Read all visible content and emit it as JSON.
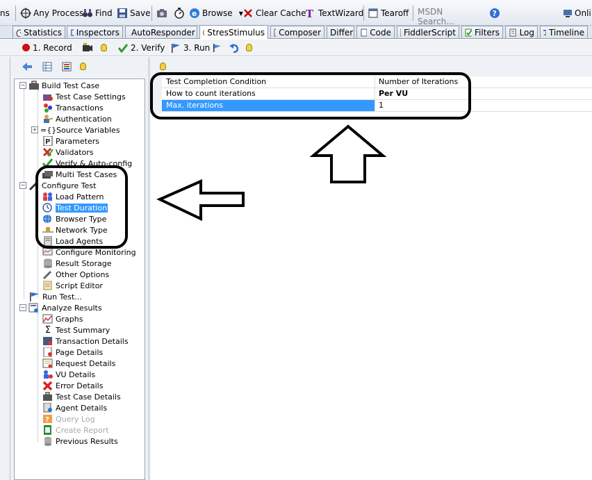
{
  "top_toolbar": {
    "partial_left": "ns",
    "any_process": "Any Process",
    "find": "Find",
    "save": "Save",
    "browse": "Browse",
    "clear_cache": "Clear Cache",
    "textwizard": "TextWizard",
    "tearoff": "Tearoff",
    "search_placeholder": "MSDN Search...",
    "online_partial": "Onli"
  },
  "tabs": [
    {
      "label": "Statistics",
      "icon": "stopwatch-icon"
    },
    {
      "label": "Inspectors",
      "icon": "inspect-icon"
    },
    {
      "label": "AutoResponder",
      "icon": "lightning-icon"
    },
    {
      "label": "StresStimulus",
      "icon": "stresstimulus-icon",
      "active": true
    },
    {
      "label": "Composer",
      "icon": "pencil-icon"
    },
    {
      "label": "Differ",
      "icon": ""
    },
    {
      "label": "Code",
      "icon": "page-icon"
    },
    {
      "label": "FiddlerScript",
      "icon": "js-icon"
    },
    {
      "label": "Filters",
      "icon": "checkbox-icon"
    },
    {
      "label": "Log",
      "icon": "page-icon"
    },
    {
      "label": "Timeline",
      "icon": "timeline-icon"
    }
  ],
  "ss_toolbar": {
    "record": "1. Record",
    "verify": "2. Verify",
    "run": "3. Run"
  },
  "tree": {
    "build_test_case": "Build Test Case",
    "test_case_settings": "Test Case Settings",
    "transactions": "Transactions",
    "authentication": "Authentication",
    "source_variables": "Source Variables",
    "parameters": "Parameters",
    "validators": "Validators",
    "verify_autoconfig": "Verify & Auto-config",
    "multi_test_cases": "Multi Test Cases",
    "configure_test": "Configure Test",
    "load_pattern": "Load Pattern",
    "test_duration": "Test Duration",
    "browser_type": "Browser Type",
    "network_type": "Network Type",
    "load_agents": "Load Agents",
    "configure_monitoring": "Configure Monitoring",
    "result_storage": "Result Storage",
    "other_options": "Other Options",
    "script_editor": "Script Editor",
    "run_test": "Run Test...",
    "analyze_results": "Analyze Results",
    "graphs": "Graphs",
    "test_summary": "Test Summary",
    "transaction_details": "Transaction Details",
    "page_details": "Page Details",
    "request_details": "Request Details",
    "vu_details": "VU Details",
    "error_details": "Error Details",
    "test_case_details": "Test Case Details",
    "agent_details": "Agent Details",
    "query_log": "Query Log",
    "create_report": "Create Report",
    "previous_results": "Previous Results"
  },
  "property_grid": {
    "rows": [
      {
        "name": "Test Completion Condition",
        "value": "Number of Iterations"
      },
      {
        "name": "How to count iterations",
        "value": "Per VU"
      },
      {
        "name": "Max. iterations",
        "value": "1"
      }
    ]
  },
  "colors": {
    "selection": "#3399ff",
    "record_red": "#d01010",
    "annotation": "#000000"
  }
}
